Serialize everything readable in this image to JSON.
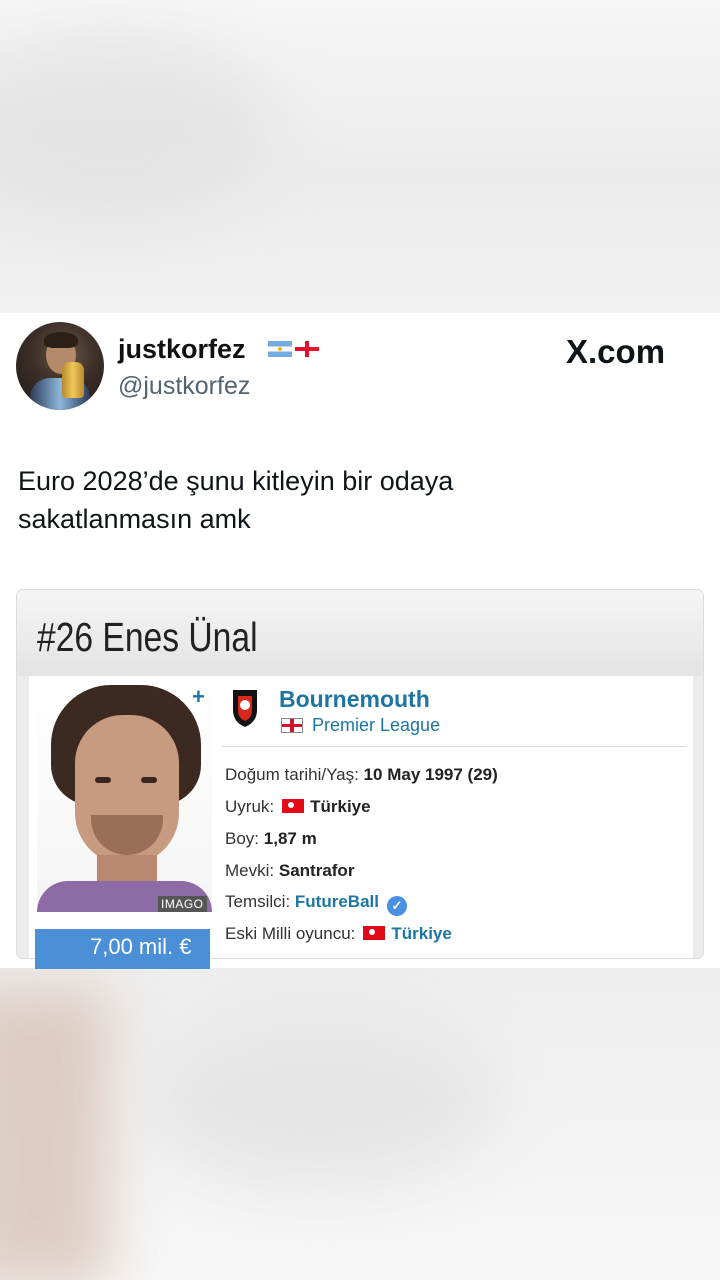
{
  "tweet": {
    "display_name": "justkorfez",
    "handle": "@justkorfez",
    "brand": "X.com",
    "text_line1": "Euro 2028’de şunu kitleyin bir odaya",
    "text_line2": "sakatlanmasın amk"
  },
  "player": {
    "number_name": "#26 Enes Ünal",
    "club": "Bournemouth",
    "league": "Premier League",
    "photo_credit": "IMAGO",
    "market_value": "7,00 mil. €",
    "details": [
      {
        "label": "Doğum tarihi/Yaş:",
        "value": "10 May 1997 (29)"
      },
      {
        "label": "Uyruk:",
        "value": "Türkiye"
      },
      {
        "label": "Boy:",
        "value": "1,87 m"
      },
      {
        "label": "Mevki:",
        "value": "Santrafor"
      },
      {
        "label": "Temsilci:",
        "value": "FutureBall"
      },
      {
        "label": "Eski Milli oyuncu:",
        "value": "Türkiye"
      }
    ]
  },
  "icons": {
    "avatar": "profile-photo",
    "flags": [
      "argentina-flag",
      "georgia-flag"
    ],
    "club_crest": "bournemouth-crest",
    "verified": "check-icon"
  },
  "colors": {
    "link": "#1d75a3",
    "value_bar": "#4b8fd6",
    "text": "#0f1419",
    "handle": "#536471"
  }
}
